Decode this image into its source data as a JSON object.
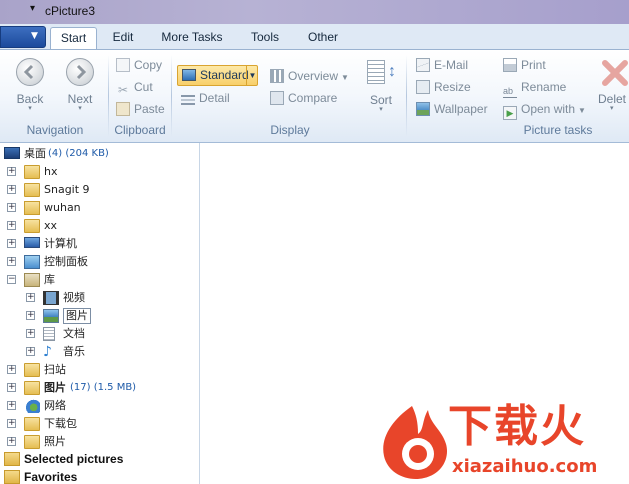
{
  "window": {
    "title": "cPicture3",
    "quick_access": "▾"
  },
  "tabs": [
    {
      "label": "Start",
      "active": true
    },
    {
      "label": "Edit",
      "active": false
    },
    {
      "label": "More Tasks",
      "active": false
    },
    {
      "label": "Tools",
      "active": false
    },
    {
      "label": "Other",
      "active": false
    }
  ],
  "ribbon": {
    "navigation": {
      "label": "Navigation",
      "back": "Back",
      "next": "Next"
    },
    "clipboard": {
      "label": "Clipboard",
      "copy": "Copy",
      "cut": "Cut",
      "paste": "Paste"
    },
    "display": {
      "label": "Display",
      "standard": "Standard",
      "detail": "Detail",
      "overview": "Overview",
      "compare": "Compare",
      "sort": "Sort"
    },
    "picture_tasks": {
      "label": "Picture tasks",
      "email": "E-Mail",
      "resize": "Resize",
      "wallpaper": "Wallpaper",
      "print": "Print",
      "rename": "Rename",
      "open_with": "Open with",
      "delete": "Delet"
    }
  },
  "tree": [
    {
      "label": "桌面",
      "count": "(4) (204 KB)",
      "icon": "desktop-icon"
    },
    {
      "label": "hx",
      "icon": "folder-icon"
    },
    {
      "label": "Snagit 9",
      "icon": "folder-icon"
    },
    {
      "label": "wuhan",
      "icon": "user-folder-icon"
    },
    {
      "label": "xx",
      "icon": "folder-icon"
    },
    {
      "label": "计算机",
      "icon": "computer-icon"
    },
    {
      "label": "控制面板",
      "icon": "control-panel-icon"
    },
    {
      "label": "库",
      "icon": "library-icon"
    },
    {
      "label": "视频",
      "icon": "video-library-icon"
    },
    {
      "label": "图片",
      "icon": "picture-library-icon"
    },
    {
      "label": "文档",
      "icon": "document-library-icon"
    },
    {
      "label": "音乐",
      "icon": "music-library-icon"
    },
    {
      "label": "扫站",
      "icon": "folder-icon"
    },
    {
      "label": "图片",
      "count": "(17) (1.5 MB)",
      "icon": "folder-icon"
    },
    {
      "label": "网络",
      "icon": "network-icon"
    },
    {
      "label": "下载包",
      "icon": "folder-icon"
    },
    {
      "label": "照片",
      "icon": "folder-icon"
    }
  ],
  "bottom": {
    "selected": "Selected pictures",
    "favorites": "Favorites"
  },
  "watermark": {
    "brand": "下载火",
    "site": "xiazaihuo.com"
  },
  "colors": {
    "accent": "#f8cf6a",
    "watermark": "#e8452a"
  }
}
